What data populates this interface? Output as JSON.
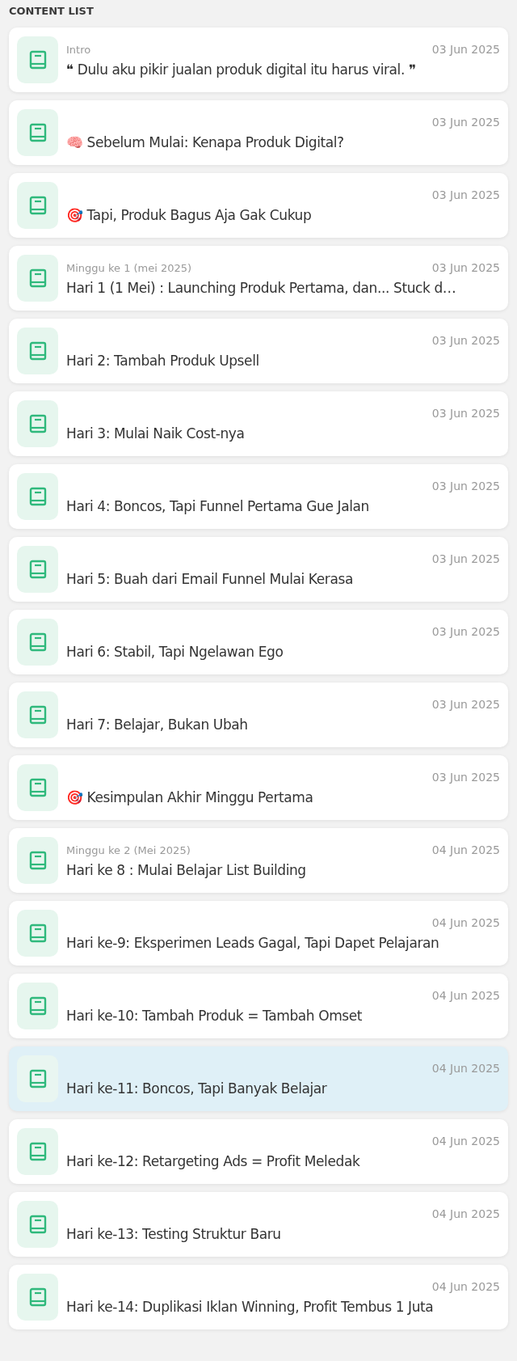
{
  "header": "CONTENT LIST",
  "items": [
    {
      "section": "Intro",
      "date": "03 Jun 2025",
      "title": "❝ Dulu aku pikir jualan produk digital itu harus viral. ❞",
      "selected": false
    },
    {
      "date": "03 Jun 2025",
      "title": "🧠 Sebelum Mulai: Kenapa Produk Digital?",
      "selected": false
    },
    {
      "date": "03 Jun 2025",
      "title": "🎯 Tapi, Produk Bagus Aja Gak Cukup",
      "selected": false
    },
    {
      "section": "Minggu ke 1 (mei 2025)",
      "date": "03 Jun 2025",
      "title": "Hari 1 (1 Mei) : Launching Produk Pertama, dan... Stuck d…",
      "selected": false
    },
    {
      "date": "03 Jun 2025",
      "title": "Hari 2: Tambah Produk Upsell",
      "selected": false
    },
    {
      "date": "03 Jun 2025",
      "title": "Hari 3: Mulai Naik Cost-nya",
      "selected": false
    },
    {
      "date": "03 Jun 2025",
      "title": "Hari 4: Boncos, Tapi Funnel Pertama Gue Jalan",
      "selected": false
    },
    {
      "date": "03 Jun 2025",
      "title": "Hari 5: Buah dari Email Funnel Mulai Kerasa",
      "selected": false
    },
    {
      "date": "03 Jun 2025",
      "title": "Hari 6: Stabil, Tapi Ngelawan Ego",
      "selected": false
    },
    {
      "date": "03 Jun 2025",
      "title": "Hari 7: Belajar, Bukan Ubah",
      "selected": false
    },
    {
      "date": "03 Jun 2025",
      "title": "🎯 Kesimpulan Akhir Minggu Pertama",
      "selected": false
    },
    {
      "section": "Minggu ke 2 (Mei 2025)",
      "date": "04 Jun 2025",
      "title": "Hari ke 8 : Mulai Belajar List Building",
      "selected": false
    },
    {
      "date": "04 Jun 2025",
      "title": "Hari ke-9: Eksperimen Leads Gagal, Tapi Dapet Pelajaran",
      "selected": false
    },
    {
      "date": "04 Jun 2025",
      "title": "Hari ke-10: Tambah Produk = Tambah Omset",
      "selected": false
    },
    {
      "date": "04 Jun 2025",
      "title": "Hari ke-11: Boncos, Tapi Banyak Belajar",
      "selected": true
    },
    {
      "date": "04 Jun 2025",
      "title": "Hari ke-12: Retargeting Ads = Profit Meledak",
      "selected": false
    },
    {
      "date": "04 Jun 2025",
      "title": "Hari ke-13: Testing Struktur Baru",
      "selected": false
    },
    {
      "date": "04 Jun 2025",
      "title": "Hari ke-14: Duplikasi Iklan Winning, Profit Tembus 1 Juta",
      "selected": false
    }
  ]
}
